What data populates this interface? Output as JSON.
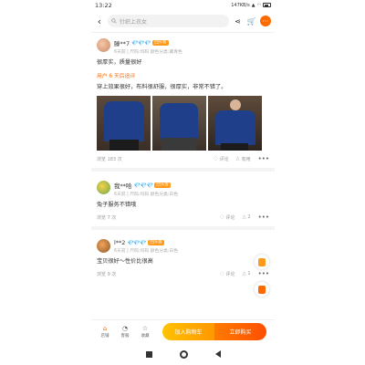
{
  "status": {
    "time": "13:22",
    "speed": "147KB/s"
  },
  "search": {
    "placeholder": "针织上衣女"
  },
  "reviews": [
    {
      "name": "滕**7",
      "gems": "💎💎💎",
      "badge": "回头客",
      "meta": "6天前 | 尺码:均码 颜色分类:藏青色",
      "text": "很厚实，质量很好",
      "append_label": "用户 6 天后追评",
      "append_text": "穿上效果很好，布料很舒服，很厚实，非常不错了。",
      "views": "浏览 183 次",
      "comment_label": "评论",
      "like_label": "有用",
      "more": "•••"
    },
    {
      "name": "我**哈",
      "gems": "💎💎💎",
      "badge": "回头客",
      "meta": "6天前 | 尺码:均码 颜色分类:白色",
      "text": "兔子服务不错哦",
      "views": "浏览 7 次",
      "comment_label": "评论",
      "like_count": "2",
      "more": "•••"
    },
    {
      "name": "l**2",
      "gems": "💎💎💎",
      "badge": "回头客",
      "meta": "6天前 | 尺码:均码 颜色分类:白色",
      "text": "宝贝很好～性价比很高",
      "views": "浏览 9 次",
      "comment_label": "评论",
      "like_count": "1",
      "more": "•••"
    }
  ],
  "bottom": {
    "shop": "店铺",
    "service": "客服",
    "favorite": "收藏",
    "cart": "加入购物车",
    "buy": "立即购买"
  },
  "colors": {
    "accent": "#ff6a00",
    "cart": "#ffb300",
    "buy": "#ff5000"
  }
}
